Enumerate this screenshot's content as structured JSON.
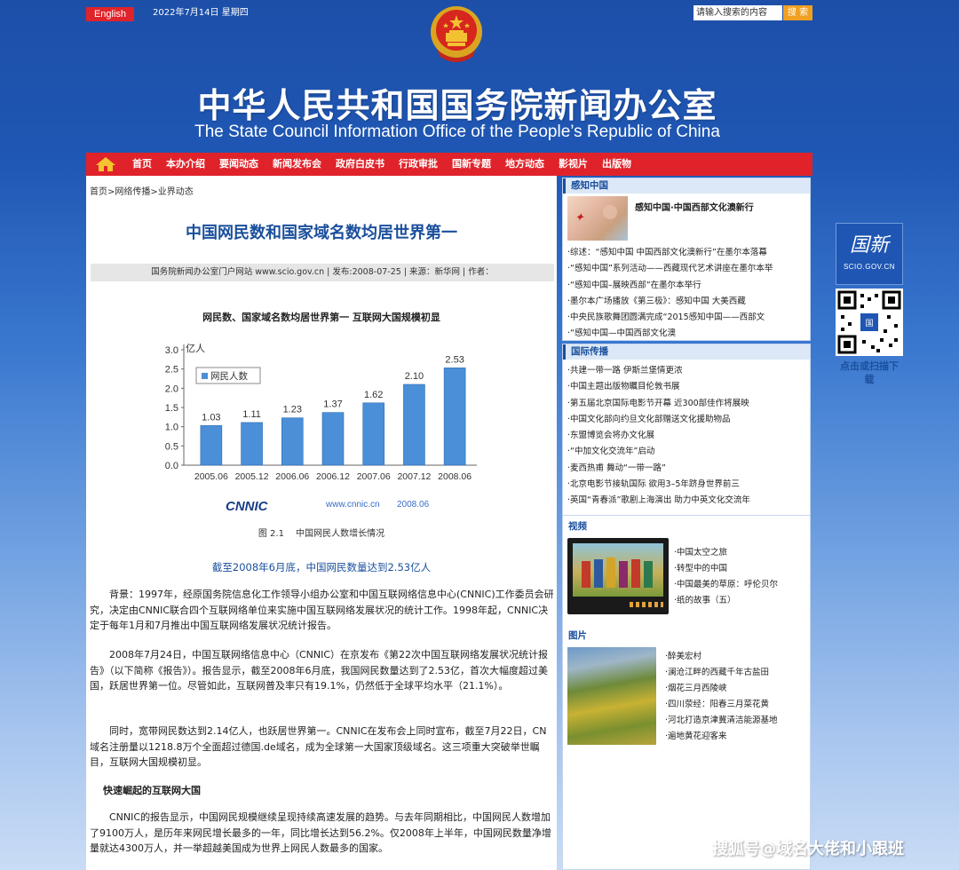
{
  "topbar": {
    "english_label": "English",
    "date": "2022年7月14日 星期四",
    "search_placeholder": "请输入搜索的内容",
    "search_button": "搜 索"
  },
  "header": {
    "title_cn": "中华人民共和国国务院新闻办公室",
    "title_en": "The State Council Information Office of the People’s Republic of China"
  },
  "nav": {
    "items": [
      "首页",
      "本办介绍",
      "要闻动态",
      "新闻发布会",
      "政府白皮书",
      "行政审批",
      "国新专题",
      "地方动态",
      "影视片",
      "出版物"
    ]
  },
  "article": {
    "breadcrumb": "首页>网络传播>业界动态",
    "title": "中国网民数和国家域名数均居世界第一",
    "meta": "国务院新闻办公室门户网站 www.scio.gov.cn | 发布:2008-07-25 | 来源：新华网 | 作者：",
    "figure_caption": "图 2.1　 中国网民人数增长情况",
    "subheading": "截至2008年6月底，中国网民数量达到2.53亿人",
    "para1": "背景：1997年，经原国务院信息化工作领导小组办公室和中国互联网络信息中心(CNNIC)工作委员会研究，决定由CNNIC联合四个互联网络单位来实施中国互联网络发展状况的统计工作。1998年起，CNNIC决定于每年1月和7月推出中国互联网络发展状况统计报告。",
    "para2": "2008年7月24日，中国互联网络信息中心（CNNIC）在京发布《第22次中国互联网络发展状况统计报告》（以下简称《报告》）。报告显示，截至2008年6月底，我国网民数量达到了2.53亿，首次大幅度超过美国，跃居世界第一位。尽管如此，互联网普及率只有19.1%，仍然低于全球平均水平（21.1%）。",
    "para3": "同时，宽带网民数达到2.14亿人，也跃居世界第一。CNNIC在发布会上同时宣布，截至7月22日，CN域名注册量以1218.8万个全面超过德国.de域名，成为全球第一大国家顶级域名。这三项重大突破举世瞩目，互联网大国规模初显。",
    "section_heading": "快速崛起的互联网大国",
    "para4": "CNNIC的报告显示，中国网民规模继续呈现持续高速发展的趋势。与去年同期相比，中国网民人数增加了9100万人，是历年来网民增长最多的一年，同比增长达到56.2%。仅2008年上半年，中国网民数量净增量就达4300万人，并一举超越美国成为世界上网民人数最多的国家。"
  },
  "chart_data": {
    "type": "bar",
    "title": "网民数、国家域名数均居世界第一 互联网大国规模初显",
    "ylabel": "亿人",
    "legend": "网民人数",
    "categories": [
      "2005.06",
      "2005.12",
      "2006.06",
      "2006.12",
      "2007.06",
      "2007.12",
      "2008.06"
    ],
    "values": [
      1.03,
      1.11,
      1.23,
      1.37,
      1.62,
      2.1,
      2.53
    ],
    "yticks": [
      "0.0",
      "0.5",
      "1.0",
      "1.5",
      "2.0",
      "2.5",
      "3.0"
    ],
    "ylim": [
      0,
      3.0
    ],
    "source_logo": "CNNIC",
    "source_url": "www.cnnic.cn",
    "source_date": "2008.06",
    "bar_color": "#4a8fd8",
    "grid": false,
    "legend_position": "top-left"
  },
  "sidebar": {
    "panel1": {
      "header": "感知中国",
      "feature_title": "感知中国·中国西部文化澳新行",
      "items": [
        "·综述：“感知中国 中国西部文化澳新行”在墨尔本落幕",
        "·“感知中国”系列活动——西藏现代艺术讲座在墨尔本举",
        "·“感知中国–展映西部”在墨尔本举行",
        "·墨尔本广场播放《第三极》：感知中国 大美西藏",
        "·中央民族歌舞团圆满完成“2015感知中国——西部文",
        "·“感知中国—中国西部文化澳"
      ]
    },
    "panel2": {
      "header": "国际传播",
      "items": [
        "·共建一带一路 伊斯兰堡情更浓",
        "·中国主题出版物瞩目伦敦书展",
        "·第五届北京国际电影节开幕 近300部佳作将展映",
        "·中国文化部向约旦文化部赠送文化援助物品",
        "·东盟博览会将办文化展",
        "·“中加文化交流年”启动",
        "·麦西热甫 舞动“一带一路”",
        "·北京电影节接轨国际 欲用3–5年跻身世界前三",
        "·英国“青春派”歌剧上海演出 助力中英文化交流年"
      ]
    },
    "panel3": {
      "video_header": "视频",
      "video_items": [
        "·中国太空之旅",
        "·转型中的中国",
        "·中国最美的草原：呼伦贝尔",
        "·纸的故事（五）"
      ],
      "photo_header": "图片",
      "photo_items": [
        "·醉美宏村",
        "·澜沧江畔的西藏千年古盐田",
        "·烟花三月西陵峡",
        "·四川荥经：阳春三月菜花黄",
        "·河北打造京津冀清洁能源基地",
        "·遍地黄花迎客来"
      ]
    }
  },
  "float": {
    "logo_cn": "国新",
    "logo_en": "SCIO.GOV.CN",
    "caption": "点击或扫描下载"
  },
  "watermark": "搜狐号@域名大佬和小跟班",
  "colors": {
    "nav_red": "#e0232a",
    "title_blue": "#1a4f9c",
    "search_orange": "#f0a022"
  }
}
